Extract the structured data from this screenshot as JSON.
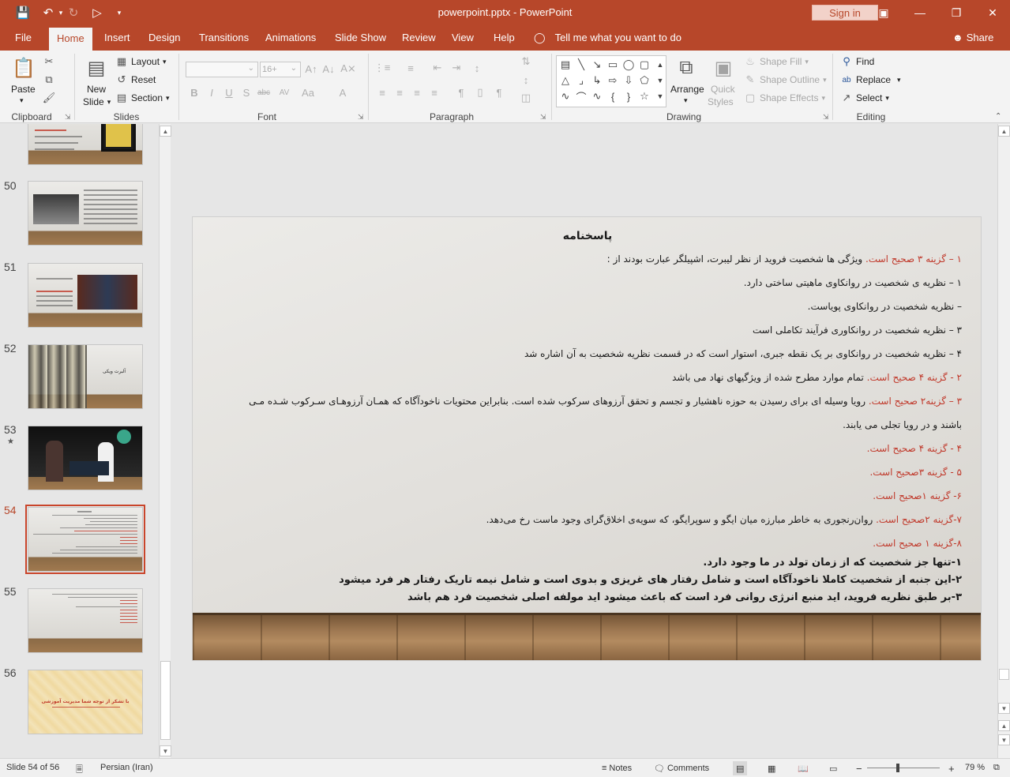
{
  "window": {
    "title": "powerpoint.pptx  -  PowerPoint",
    "sign_in": "Sign in"
  },
  "tabs": [
    "File",
    "Home",
    "Insert",
    "Design",
    "Transitions",
    "Animations",
    "Slide Show",
    "Review",
    "View",
    "Help"
  ],
  "active_tab": "Home",
  "tell_me": "Tell me what you want to do",
  "share": "Share",
  "ribbon": {
    "clipboard": {
      "label": "Clipboard",
      "paste": "Paste"
    },
    "slides": {
      "label": "Slides",
      "new_slide_1": "New",
      "new_slide_2": "Slide",
      "layout": "Layout",
      "reset": "Reset",
      "section": "Section"
    },
    "font": {
      "label": "Font",
      "size_placeholder": "16+"
    },
    "paragraph": {
      "label": "Paragraph"
    },
    "drawing": {
      "label": "Drawing",
      "arrange": "Arrange",
      "quick_styles_1": "Quick",
      "quick_styles_2": "Styles",
      "shape_fill": "Shape Fill",
      "shape_outline": "Shape Outline",
      "shape_effects": "Shape Effects"
    },
    "editing": {
      "label": "Editing",
      "find": "Find",
      "replace": "Replace",
      "select": "Select"
    }
  },
  "thumbnails": [
    {
      "num": "",
      "star": false
    },
    {
      "num": "50",
      "star": false
    },
    {
      "num": "51",
      "star": false
    },
    {
      "num": "52",
      "star": false,
      "caption": "آلبرت ویکی"
    },
    {
      "num": "53",
      "star": true
    },
    {
      "num": "54",
      "star": false,
      "selected": true
    },
    {
      "num": "55",
      "star": false
    },
    {
      "num": "56",
      "star": false,
      "caption": "با تشکر از توجه شما مدیریت آموزشی"
    }
  ],
  "slide": {
    "title": "پاسخنامه",
    "lines": [
      {
        "red": "۱ – گزینه ۳ صحیح است.",
        "text": " ویژگی ها شخصیت فروید از نظر لیبرت، اشپیلگر عبارت بودند از :"
      },
      {
        "red": "",
        "text": "۱ – نظریه ی شخصیت در روانکاوی ماهیتی ساختی دارد."
      },
      {
        "red": "",
        "text": "– نظریه شخصیت در روانکاوی پویاست."
      },
      {
        "red": "",
        "text": "۳ – نظریه شخصیت در روانکاوری فرآیند تکاملی است"
      },
      {
        "red": "",
        "text": "۴ – نظریه شخصیت در روانکاوی بر یک نقطه جبری، استوار است که در قسمت نظریه شخصیت به آن اشاره شد"
      },
      {
        "red": "۲ - گزینه ۴ صحیح است.",
        "text": " تمام موارد مطرح شده از ویژگیهای نهاد می باشد"
      },
      {
        "red": "۳ – گزینه۲ صحیح است.",
        "text": " رویا وسیله ای برای رسیدن به حوزه ناهشیار و تجسم و تحقق آرزوهای سرکوب شده است. بنابراین محتویات ناخودآگاه که همـان آرزوهـای سـرکوب شـده مـی"
      },
      {
        "red": "",
        "text": "باشند و در رویا تجلی می یابند."
      },
      {
        "red": "۴ - گزینه ۴ صحیح است.",
        "text": ""
      },
      {
        "red": "۵ - گزینه ۳صحیح است.",
        "text": ""
      },
      {
        "red": "۶-  گزینه ۱صحیح است.",
        "text": ""
      },
      {
        "red": "۷-گزینه ۲صحیح است.",
        "text": " روان‌رنجوری به خاطر مبارزه میان ایگو و سوپرایگو، که سویه‌ی اخلاق‌گرای وجود ماست رخ می‌دهد."
      },
      {
        "red": "۸-گزینه ۱ صحیح است.",
        "text": ""
      }
    ],
    "bold_lines": [
      "۱-تنها جز شخصیت که از زمان تولد در ما وجود دارد.",
      "۲-این جنبه از شخصیت کاملا ناخودآگاه است و شامل رفتار های غریزی و بدوی است و شامل نیمه تاریک رفتار هر فرد میشود",
      "۳-بر طبق نظریه فروید، اید منبع انرژی روانی فرد است که باعث میشود اید مولفه اصلی شخصیت فرد هم باشد"
    ]
  },
  "status": {
    "slide_info": "Slide 54 of 56",
    "language": "Persian (Iran)",
    "notes": "Notes",
    "comments": "Comments",
    "zoom_minus": "−",
    "zoom_plus": "+",
    "zoom": "79 %"
  },
  "colors": {
    "accent": "#b7472a",
    "answer_red": "#c0392b"
  }
}
